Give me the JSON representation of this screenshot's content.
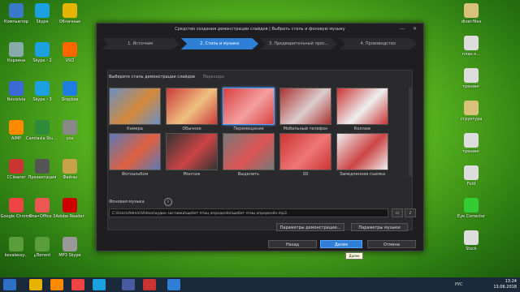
{
  "desktop_left": [
    {
      "label": "Компьютер",
      "color": "#3a78c8"
    },
    {
      "label": "Корзина",
      "color": "#8aa"
    },
    {
      "label": "Nevizivia",
      "color": "#3a6ad6"
    },
    {
      "label": "AIMP",
      "color": "#ff8a00"
    },
    {
      "label": "CCleaner",
      "color": "#c33"
    },
    {
      "label": "Google Chrome",
      "color": "#e44"
    },
    {
      "label": "kevalessy...",
      "color": "#5a9e3a"
    }
  ],
  "desktop_col2": [
    {
      "label": "Skype",
      "color": "#1ba1e2"
    },
    {
      "label": "Skype - 2",
      "color": "#1ba1e2"
    },
    {
      "label": "Skype - 3",
      "color": "#1ba1e2"
    },
    {
      "label": "Camtasia Studio 7",
      "color": "#2e8b3a"
    },
    {
      "label": "Презентация",
      "color": "#555"
    },
    {
      "label": "One•Office 3",
      "color": "#e55"
    },
    {
      "label": "µTorrent",
      "color": "#5a9e3a"
    }
  ],
  "desktop_col3": [
    {
      "label": "Облачные",
      "color": "#e6b400"
    },
    {
      "label": "VSO",
      "color": "#f60"
    },
    {
      "label": "Dropbox",
      "color": "#1e7ee0"
    },
    {
      "label": "yox",
      "color": "#888"
    },
    {
      "label": "Файлы",
      "color": "#c9a14a"
    },
    {
      "label": "Adobe Reader",
      "color": "#c00"
    },
    {
      "label": "MP3 Skype",
      "color": "#999"
    }
  ],
  "desktop_right": [
    {
      "label": "diver-files",
      "color": "#d8c27a"
    },
    {
      "label": "план к...",
      "color": "#ddd"
    },
    {
      "label": "тренинг",
      "color": "#ddd"
    },
    {
      "label": "структура",
      "color": "#d8c27a"
    },
    {
      "label": "тренинг",
      "color": "#ddd"
    },
    {
      "label": "Fold",
      "color": "#ddd"
    },
    {
      "label": "Eye Corrector",
      "color": "#3c3"
    },
    {
      "label": "Stock",
      "color": "#ddd"
    }
  ],
  "window": {
    "title": "Средство создания демонстрации слайдов | Выбрать стиль и фоновую музыку",
    "minimize": "—",
    "close": "✕"
  },
  "steps": [
    {
      "label": "1. Источник",
      "active": false
    },
    {
      "label": "2. Стиль и музыка",
      "active": true
    },
    {
      "label": "3. Предварительный прос...",
      "active": false
    },
    {
      "label": "4. Производство",
      "active": false
    }
  ],
  "tabs": {
    "styles": "Выберите стиль демонстрации слайдов",
    "transitions": "Переходы"
  },
  "styles": [
    {
      "label": "Камера",
      "c1": "#6b8fc2",
      "c2": "#d58a3a"
    },
    {
      "label": "Обычное",
      "c1": "#c93a3a",
      "c2": "#f0c080"
    },
    {
      "label": "Перемещение",
      "c1": "#d84040",
      "c2": "#f5a0a0"
    },
    {
      "label": "Мобильный телефон",
      "c1": "#a33",
      "c2": "#dcc"
    },
    {
      "label": "Коллаж",
      "c1": "#c33",
      "c2": "#eee"
    },
    {
      "label": "Фотоальбом",
      "c1": "#5a7ab5",
      "c2": "#e06040"
    },
    {
      "label": "Монтаж",
      "c1": "#333",
      "c2": "#c44"
    },
    {
      "label": "Выделить",
      "c1": "#777",
      "c2": "#d55"
    },
    {
      "label": "3D",
      "c1": "#c33",
      "c2": "#e77"
    },
    {
      "label": "Замедленная съемка",
      "c1": "#eee",
      "c2": "#c44"
    }
  ],
  "music": {
    "label": "Фоновая музыка",
    "path": "C:\\Users\\Admin\\Videos\\аудио заставки\\щебет птиц определён\\щебет птиц определён.mp3"
  },
  "buttons": {
    "slideshow_params": "Параметры демонстрации...",
    "music_params": "Параметры музыки",
    "back": "Назад",
    "next": "Далее",
    "cancel": "Отмена"
  },
  "tooltip": "Далее",
  "taskbar": {
    "lang": "РУС",
    "time": "13:24",
    "date": "13.06.2018"
  }
}
